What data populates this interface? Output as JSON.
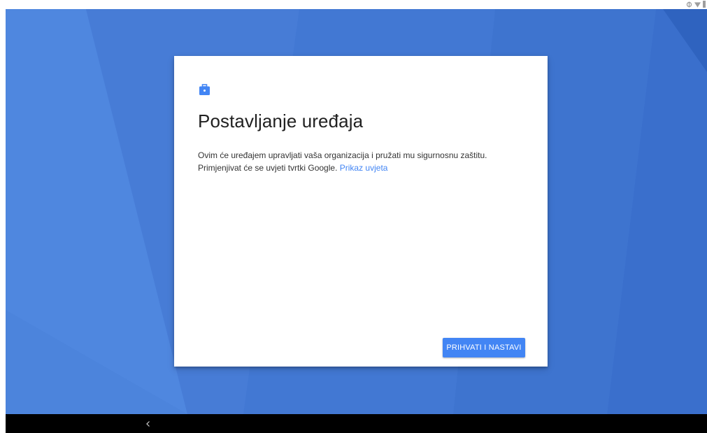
{
  "setup_card": {
    "icon": "briefcase-icon",
    "title": "Postavljanje uređaja",
    "line1": "Ovim će uređajem upravljati vaša organizacija i pružati mu sigurnosnu zaštitu.",
    "line2_prefix": "Primjenjivat će se uvjeti tvrtki Google. ",
    "terms_link": "Prikaz uvjeta",
    "accept_button": "PRIHVATI I NASTAVI"
  },
  "status_bar": {
    "icons": [
      "vpn-key-icon",
      "wifi-icon",
      "battery-icon"
    ]
  },
  "nav_bar": {
    "icons": [
      "back-icon"
    ]
  },
  "colors": {
    "accent": "#4285f4",
    "wallpaper": "#4a7fd9",
    "nav_bar": "#000000"
  }
}
